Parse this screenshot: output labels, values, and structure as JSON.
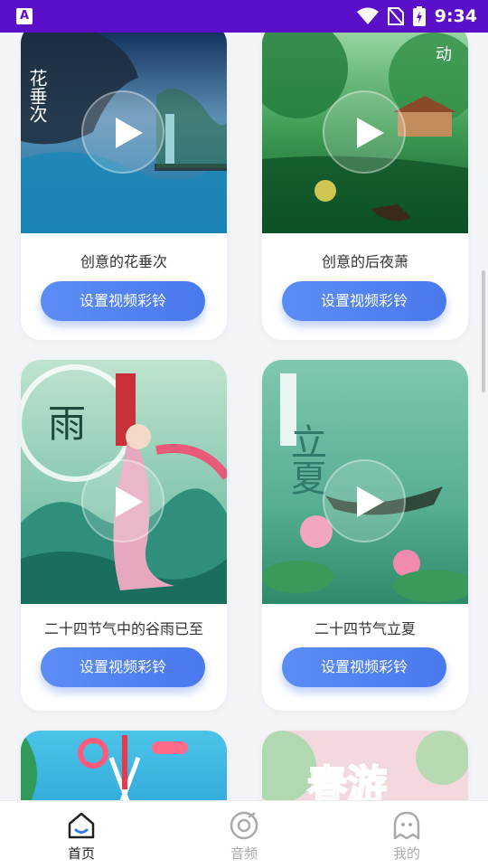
{
  "status_bar": {
    "time": "9:34",
    "app_badge": "A"
  },
  "cards": [
    {
      "title": "创意的花垂次",
      "button_label": "设置视频彩铃",
      "overlay_text": "花垂次"
    },
    {
      "title": "创意的后夜萧",
      "button_label": "设置视频彩铃",
      "overlay_text": "动"
    },
    {
      "title": "二十四节气中的谷雨已至",
      "button_label": "设置视频彩铃",
      "overlay_text": "雨"
    },
    {
      "title": "二十四节气立夏",
      "button_label": "设置视频彩铃",
      "overlay_text": "立夏"
    },
    {
      "title": "",
      "button_label": "",
      "overlay_text": ""
    },
    {
      "title": "",
      "button_label": "",
      "overlay_text": "春游"
    }
  ],
  "tabs": [
    {
      "label": "首页",
      "icon": "home-icon",
      "active": true
    },
    {
      "label": "音频",
      "icon": "disc-icon",
      "active": false
    },
    {
      "label": "我的",
      "icon": "profile-icon",
      "active": false
    }
  ],
  "colors": {
    "status_bar": "#5a0fc8",
    "button": "#4a78ee",
    "tab_active": "#222222",
    "tab_inactive": "#aaaaaa"
  }
}
